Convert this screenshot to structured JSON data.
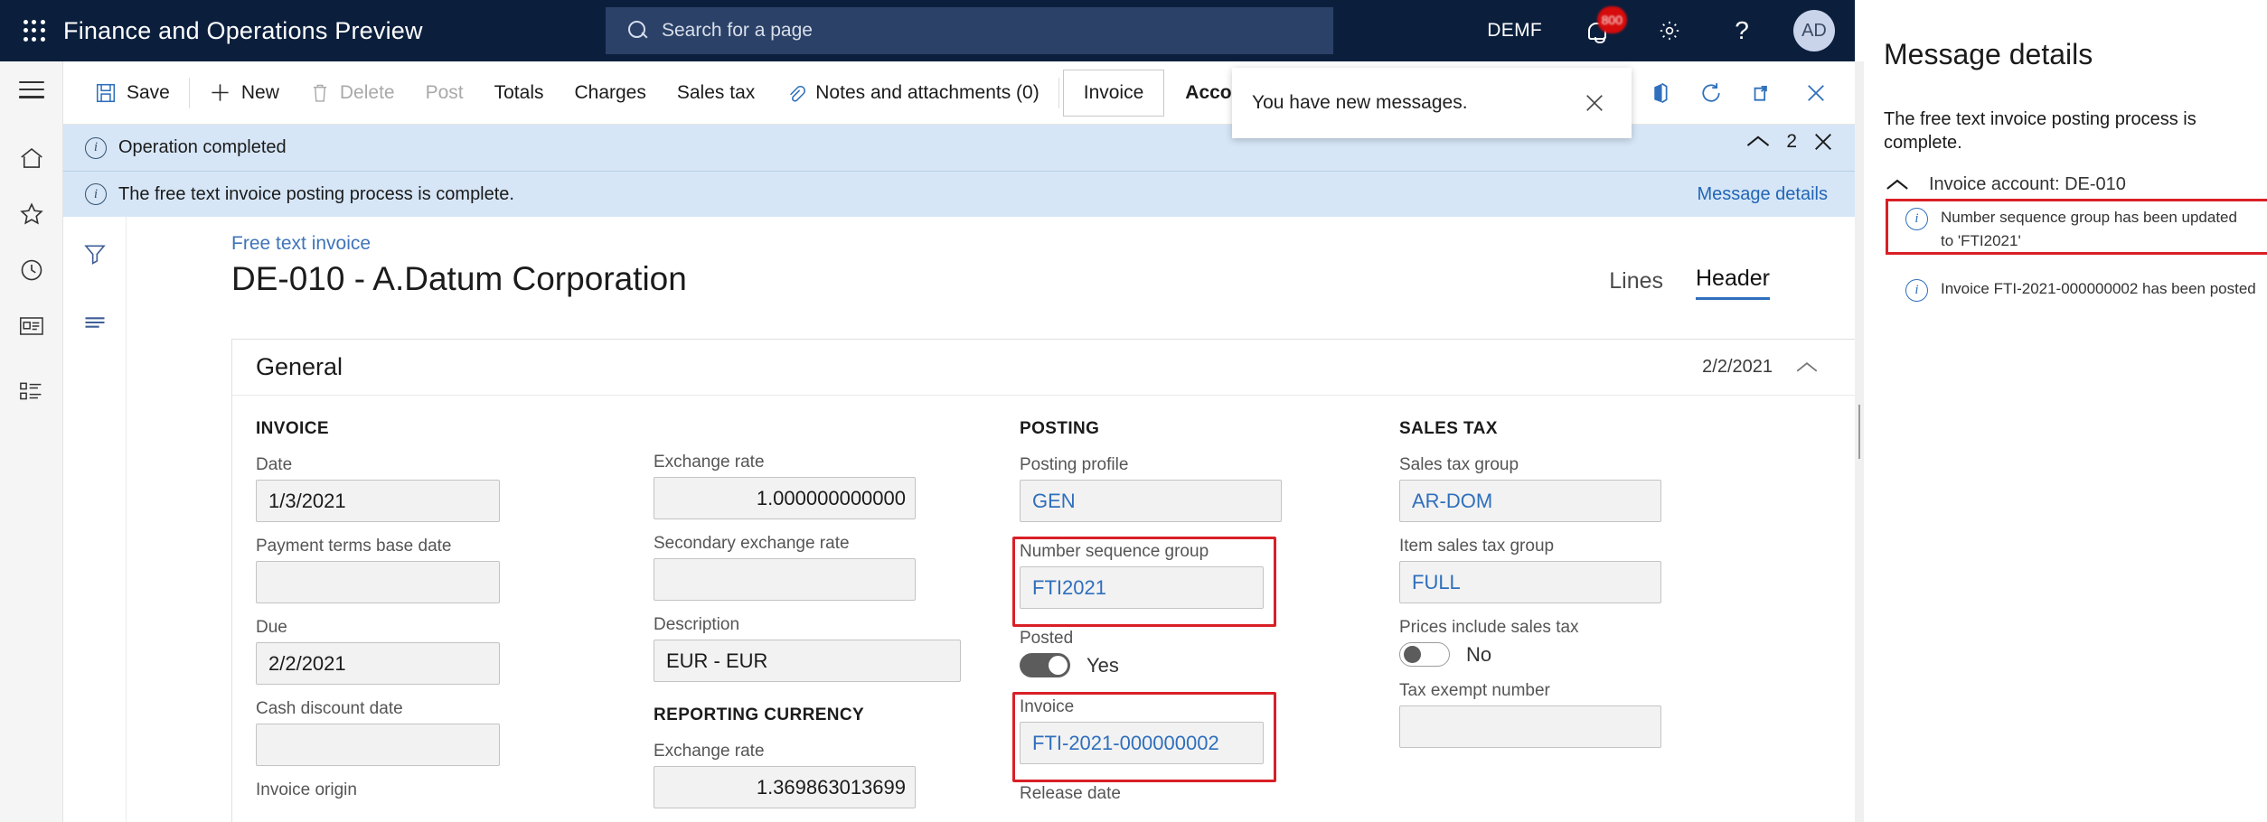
{
  "topbar": {
    "app_title": "Finance and Operations Preview",
    "waffle_icon": "app-launcher-icon",
    "search": {
      "placeholder": "Search for a page",
      "icon": "search-icon"
    },
    "company": "DEMF",
    "notifications": {
      "icon": "bell-icon",
      "badge": "800"
    },
    "settings_icon": "gear-icon",
    "help_icon": "question-mark-icon",
    "avatar_initials": "AD"
  },
  "rail": {
    "menu_icon": "hamburger-icon",
    "items": [
      {
        "icon": "home-icon",
        "name": "home"
      },
      {
        "icon": "star-icon",
        "name": "favorites"
      },
      {
        "icon": "clock-icon",
        "name": "recent"
      },
      {
        "icon": "workspace-icon",
        "name": "workspaces"
      },
      {
        "icon": "modules-list-icon",
        "name": "modules"
      }
    ]
  },
  "commandbar": {
    "buttons": [
      {
        "label": "Save",
        "icon": "save-icon",
        "disabled": false
      },
      {
        "label": "New",
        "icon": "plus-icon",
        "disabled": false
      },
      {
        "label": "Delete",
        "icon": "trash-icon",
        "disabled": true
      },
      {
        "label": "Post",
        "icon": "",
        "disabled": true
      },
      {
        "label": "Totals",
        "icon": "",
        "disabled": false
      },
      {
        "label": "Charges",
        "icon": "",
        "disabled": false
      },
      {
        "label": "Sales tax",
        "icon": "",
        "disabled": false
      },
      {
        "label": "Notes and attachments (0)",
        "icon": "paperclip-icon",
        "disabled": false
      }
    ],
    "tabs": [
      {
        "label": "Invoice",
        "active": true
      },
      {
        "label": "Accounting",
        "active": false
      }
    ],
    "right_icons": [
      {
        "icon": "office-app-icon",
        "name": "open-in-office"
      },
      {
        "icon": "refresh-icon",
        "name": "refresh"
      },
      {
        "icon": "popout-icon",
        "name": "open-in-new-window"
      },
      {
        "icon": "close-icon",
        "name": "close-page"
      }
    ]
  },
  "toast": {
    "text": "You have new messages.",
    "close_icon": "close-icon"
  },
  "messagebar": {
    "rows": [
      {
        "icon": "info-icon",
        "text": "Operation completed"
      },
      {
        "icon": "info-icon",
        "text": "The free text invoice posting process is complete."
      }
    ],
    "link": "Message details",
    "collapse_icon": "chevron-up-icon",
    "count": "2",
    "close_icon": "close-icon"
  },
  "sidetools": [
    {
      "icon": "filter-icon",
      "name": "filter-pane"
    },
    {
      "icon": "lines-icon",
      "name": "related-information"
    }
  ],
  "page": {
    "breadcrumb": "Free text invoice",
    "title": "DE-010 - A.Datum Corporation",
    "tabs": [
      {
        "label": "Lines",
        "active": false
      },
      {
        "label": "Header",
        "active": true
      }
    ]
  },
  "card": {
    "title": "General",
    "date": "2/2/2021",
    "collapse_icon": "chevron-up-icon",
    "columns": {
      "invoice": {
        "group": "INVOICE",
        "fields": [
          {
            "label": "Date",
            "value": "1/3/2021"
          },
          {
            "label": "Payment terms base date",
            "value": ""
          },
          {
            "label": "Due",
            "value": "2/2/2021"
          },
          {
            "label": "Cash discount date",
            "value": ""
          },
          {
            "label": "Invoice origin",
            "value": ""
          }
        ]
      },
      "currency": {
        "fields": [
          {
            "label": "Exchange rate",
            "value": "1.000000000000",
            "numeric": true
          },
          {
            "label": "Secondary exchange rate",
            "value": "",
            "numeric": true
          },
          {
            "label": "Description",
            "value": "EUR - EUR",
            "numeric": false
          }
        ],
        "group2": "REPORTING CURRENCY",
        "fields2": [
          {
            "label": "Exchange rate",
            "value": "1.369863013699",
            "numeric": true
          }
        ]
      },
      "posting": {
        "group": "POSTING",
        "fields": [
          {
            "label": "Posting profile",
            "value": "GEN",
            "link": true,
            "highlighted": false
          },
          {
            "label": "Number sequence group",
            "value": "FTI2021",
            "link": true,
            "highlighted": true
          }
        ],
        "posted": {
          "label": "Posted",
          "value": "Yes",
          "state": "on"
        },
        "fields2": [
          {
            "label": "Invoice",
            "value": "FTI-2021-000000002",
            "link": true,
            "highlighted": true
          },
          {
            "label": "Release date",
            "value": "",
            "link": false,
            "highlighted": false
          }
        ]
      },
      "salestax": {
        "group": "SALES TAX",
        "fields": [
          {
            "label": "Sales tax group",
            "value": "AR-DOM",
            "link": true
          },
          {
            "label": "Item sales tax group",
            "value": "FULL",
            "link": true
          }
        ],
        "prices_include": {
          "label": "Prices include sales tax",
          "value": "No",
          "state": "off"
        },
        "fields2": [
          {
            "label": "Tax exempt number",
            "value": "",
            "link": false
          }
        ]
      }
    }
  },
  "rightpane": {
    "title": "Message details",
    "summary": "The free text invoice posting process is complete.",
    "account_collapse_icon": "chevron-up-icon",
    "account_label": "Invoice account: DE-010",
    "details": [
      {
        "icon": "info-icon",
        "text": "Number sequence group has been updated to 'FTI2021'",
        "highlighted": true
      },
      {
        "icon": "info-icon",
        "text": "Invoice FTI-2021-000000002 has been posted",
        "highlighted": false
      }
    ]
  }
}
